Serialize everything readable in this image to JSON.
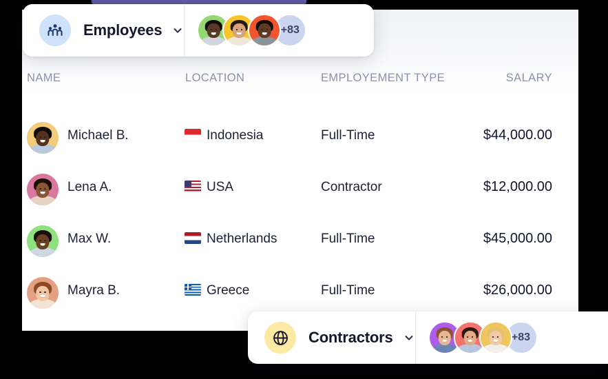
{
  "cards": {
    "employees": {
      "icon": "people-group-icon",
      "icon_bg": "#cfe2fb",
      "label": "Employees",
      "chevron": "chevron-down-icon",
      "overflow_count": "+83",
      "avatars": [
        {
          "name": "avatar-employee-1",
          "bg": "#93d872",
          "skin": "#5a3a26",
          "hair": "#140e0a",
          "shirt": "#cfd6de"
        },
        {
          "name": "avatar-employee-2",
          "bg": "#f6c62a",
          "skin": "#d8a27d",
          "hair": "#231812",
          "shirt": "#efe7dc"
        },
        {
          "name": "avatar-employee-3",
          "bg": "#f2542d",
          "skin": "#5d3a25",
          "hair": "#120c08",
          "shirt": "#8d939b"
        }
      ]
    },
    "contractors": {
      "icon": "globe-icon",
      "icon_bg": "#fbe9a4",
      "label": "Contractors",
      "chevron": "chevron-down-icon",
      "overflow_count": "+83",
      "avatars": [
        {
          "name": "avatar-contractor-1",
          "bg": "#ad5de8",
          "skin": "#e8b695",
          "hair": "#8a5230",
          "shirt": "#6d83b5"
        },
        {
          "name": "avatar-contractor-2",
          "bg": "#f4736f",
          "skin": "#e2ab86",
          "hair": "#2a1a12",
          "shirt": "#b9c6e0"
        },
        {
          "name": "avatar-contractor-3",
          "bg": "#efc65f",
          "skin": "#f0cbab",
          "hair": "#e3c069",
          "shirt": "#f3f0ea"
        }
      ]
    }
  },
  "table": {
    "columns": [
      {
        "key": "name",
        "label": "NAME"
      },
      {
        "key": "location",
        "label": "LOCATION"
      },
      {
        "key": "type",
        "label": "EMPLOYEMENT TYPE"
      },
      {
        "key": "salary",
        "label": "SALARY"
      }
    ],
    "rows": [
      {
        "name": "Michael B.",
        "location": "Indonesia",
        "flag": "flag-indonesia",
        "type": "Full-Time",
        "salary": "$44,000.00",
        "avatar": {
          "bg": "#f2cd79",
          "skin": "#53331f",
          "hair": "#120c08",
          "shirt": "#b8cadb"
        }
      },
      {
        "name": "Lena A.",
        "location": "USA",
        "flag": "flag-usa",
        "type": "Contractor",
        "salary": "$12,000.00",
        "avatar": {
          "bg": "#d9789f",
          "skin": "#8a5534",
          "hair": "#1a1008",
          "shirt": "#e6d3c2"
        }
      },
      {
        "name": "Max W.",
        "location": "Netherlands",
        "flag": "flag-netherlands",
        "type": "Full-Time",
        "salary": "$45,000.00",
        "avatar": {
          "bg": "#8fe07f",
          "skin": "#6b4126",
          "hair": "#15100b",
          "shirt": "#cfd7e2"
        }
      },
      {
        "name": "Mayra B.",
        "location": "Greece",
        "flag": "flag-greece",
        "type": "Full-Time",
        "salary": "$26,000.00",
        "avatar": {
          "bg": "#e2a183",
          "skin": "#f0c6a4",
          "hair": "#8e4a24",
          "shirt": "#f2e3d6"
        }
      }
    ]
  }
}
